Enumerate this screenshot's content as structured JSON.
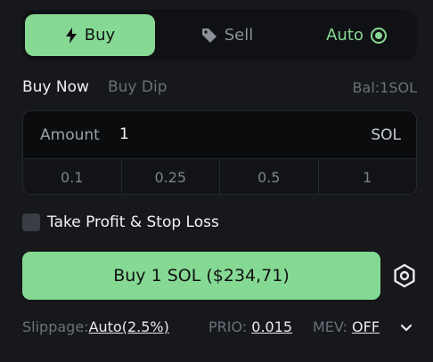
{
  "tabs": {
    "buy": "Buy",
    "sell": "Sell",
    "auto": "Auto"
  },
  "subtabs": {
    "buy_now": "Buy Now",
    "buy_dip": "Buy Dip"
  },
  "balance": "Bal:1SOL",
  "amount": {
    "label": "Amount",
    "value": "1",
    "unit": "SOL"
  },
  "presets": [
    "0.1",
    "0.25",
    "0.5",
    "1"
  ],
  "take_profit": {
    "label": "Take Profit & Stop Loss",
    "checked": false
  },
  "buy_button": "Buy 1 SOL ($234,71)",
  "footer": {
    "slippage_label": "Slippage:",
    "slippage_value": "Auto(2.5%)",
    "prio_label": "PRIO:",
    "prio_value": "0.015",
    "mev_label": "MEV:",
    "mev_value": "OFF"
  },
  "icons": {
    "buy": "lightning-icon",
    "sell": "tag-icon",
    "auto": "radio-selected-icon",
    "settings": "gear-icon",
    "expand": "chevron-down-icon"
  },
  "colors": {
    "accent": "#86d993",
    "background": "#16181c",
    "muted": "#6b7079"
  }
}
